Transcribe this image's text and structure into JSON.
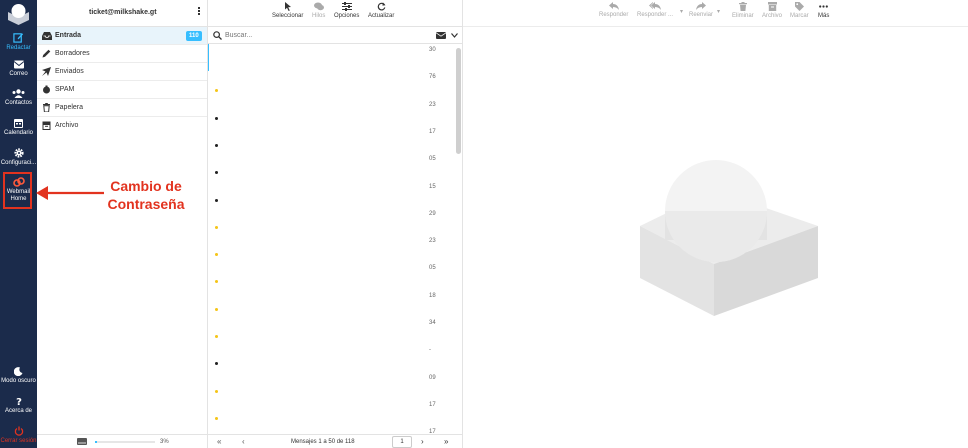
{
  "account": {
    "email": "ticket@milkshake.gt"
  },
  "nav": {
    "compose": "Redactar",
    "mail": "Correo",
    "contacts": "Contactos",
    "calendar": "Calendario",
    "settings": "Configuraci...",
    "webmail_home_1": "Webmail",
    "webmail_home_2": "Home",
    "dark_mode": "Modo oscuro",
    "about": "Acerca de",
    "logout": "Cerrar sesión"
  },
  "folders": [
    {
      "label": "Entrada",
      "icon": "inbox-icon",
      "badge": "110"
    },
    {
      "label": "Borradores",
      "icon": "pencil-icon"
    },
    {
      "label": "Enviados",
      "icon": "send-icon"
    },
    {
      "label": "SPAM",
      "icon": "spam-icon"
    },
    {
      "label": "Papelera",
      "icon": "trash-icon"
    },
    {
      "label": "Archivo",
      "icon": "archive-icon"
    }
  ],
  "quota": {
    "percent_label": "3%",
    "fraction": 0.03
  },
  "list_toolbar": {
    "select": "Seleccionar",
    "threads": "Hilos",
    "options": "Opciones",
    "refresh": "Actualizar"
  },
  "search": {
    "placeholder": "Buscar..."
  },
  "message_rows": [
    {
      "num": "30",
      "dot": ""
    },
    {
      "num": "76",
      "dot": "yellow"
    },
    {
      "num": "23",
      "dot": "black"
    },
    {
      "num": "17",
      "dot": "black"
    },
    {
      "num": "05",
      "dot": "black"
    },
    {
      "num": "15",
      "dot": "black"
    },
    {
      "num": "29",
      "dot": "yellow"
    },
    {
      "num": "23",
      "dot": "yellow"
    },
    {
      "num": "05",
      "dot": "yellow"
    },
    {
      "num": "18",
      "dot": "yellow"
    },
    {
      "num": "34",
      "dot": "yellow"
    },
    {
      "num": "-",
      "dot": "black"
    },
    {
      "num": "09",
      "dot": "yellow"
    },
    {
      "num": "17",
      "dot": "yellow"
    },
    {
      "num": "17",
      "dot": "yellow"
    }
  ],
  "pagination": {
    "label": "Mensajes 1 a 50 de 118",
    "page": "1"
  },
  "reading_toolbar": {
    "reply": "Responder",
    "reply_all": "Responder ...",
    "forward": "Reenviar",
    "delete": "Eliminar",
    "archive": "Archivo",
    "mark": "Marcar",
    "more": "Más"
  },
  "annotation": {
    "line1": "Cambio de",
    "line2": "Contraseña"
  },
  "colors": {
    "nav_bg": "#1b2b4b",
    "accent": "#37beff",
    "annotation": "#e2331f"
  }
}
